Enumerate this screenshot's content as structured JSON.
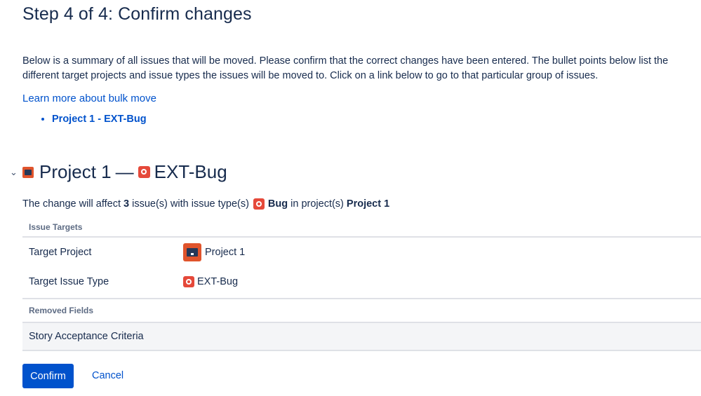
{
  "page": {
    "title": "Step 4 of 4: Confirm changes",
    "intro": "Below is a summary of all issues that will be moved. Please confirm that the correct changes have been entered. The bullet points below list the different target projects and issue types the issues will be moved to. Click on a link below to go to that particular group of issues.",
    "learn_more": "Learn more about bulk move"
  },
  "groups": [
    {
      "label": "Project 1 - EXT-Bug"
    }
  ],
  "section": {
    "project": "Project 1",
    "dash": "—",
    "issue_type": "EXT-Bug",
    "affect_prefix": "The change will affect",
    "count": "3",
    "affect_mid": "issue(s) with issue type(s)",
    "affect_type": "Bug",
    "affect_in": "in project(s)",
    "affect_project": "Project 1"
  },
  "targets": {
    "header": "Issue Targets",
    "rows": [
      {
        "key": "Target Project",
        "value": "Project 1"
      },
      {
        "key": "Target Issue Type",
        "value": "EXT-Bug"
      }
    ]
  },
  "removed": {
    "header": "Removed Fields",
    "fields": [
      "Story Acceptance Criteria"
    ]
  },
  "actions": {
    "confirm": "Confirm",
    "cancel": "Cancel"
  },
  "colors": {
    "link": "#0052cc",
    "primary_button": "#0052cc",
    "project_icon": "#e0542c",
    "bug_icon": "#e5493a"
  },
  "icons": {
    "project": "project-avatar-icon",
    "bug": "bug-icon",
    "collapse": "chevron-down-icon"
  }
}
